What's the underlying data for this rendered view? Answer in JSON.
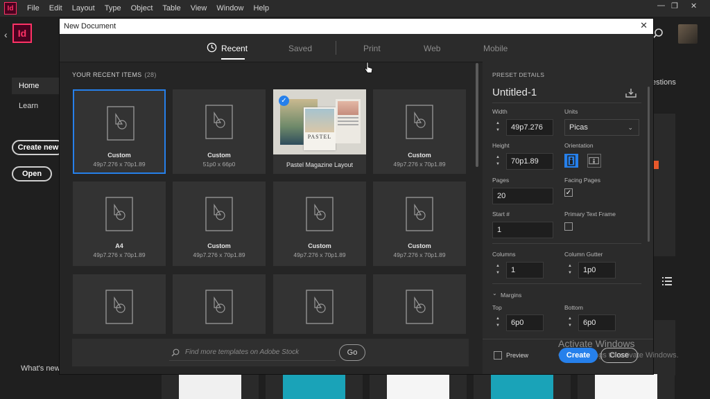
{
  "app": {
    "logo": "Id"
  },
  "menubar": {
    "items": [
      "File",
      "Edit",
      "Layout",
      "Type",
      "Object",
      "Table",
      "View",
      "Window",
      "Help"
    ]
  },
  "home": {
    "nav": [
      "Home",
      "Learn"
    ],
    "create_new": "Create new",
    "open": "Open",
    "whats_new": "What's new",
    "questions": "estions"
  },
  "dialog": {
    "title": "New Document",
    "tabs": [
      "Recent",
      "Saved",
      "Print",
      "Web",
      "Mobile"
    ],
    "recent_header": "YOUR RECENT ITEMS",
    "recent_count": "(28)",
    "cards": [
      {
        "name": "Custom",
        "dims": "49p7.276 x 70p1.89"
      },
      {
        "name": "Custom",
        "dims": "51p0 x 66p0"
      },
      {
        "name": "Pastel Magazine Layout",
        "dims": ""
      },
      {
        "name": "Custom",
        "dims": "49p7.276 x 70p1.89"
      },
      {
        "name": "A4",
        "dims": "49p7.276 x 70p1.89"
      },
      {
        "name": "Custom",
        "dims": "49p7.276 x 70p1.89"
      },
      {
        "name": "Custom",
        "dims": "49p7.276 x 70p1.89"
      },
      {
        "name": "Custom",
        "dims": "49p7.276 x 70p1.89"
      },
      {
        "name": "",
        "dims": ""
      },
      {
        "name": "",
        "dims": ""
      },
      {
        "name": "",
        "dims": ""
      },
      {
        "name": "",
        "dims": ""
      }
    ],
    "thumb_text": "PASTEL",
    "stock_placeholder": "Find more templates on Adobe Stock",
    "go": "Go"
  },
  "preset": {
    "header": "PRESET DETAILS",
    "name": "Untitled-1",
    "width_label": "Width",
    "width": "49p7.276",
    "units_label": "Units",
    "units": "Picas",
    "height_label": "Height",
    "height": "70p1.89",
    "orientation_label": "Orientation",
    "pages_label": "Pages",
    "pages": "20",
    "facing_label": "Facing Pages",
    "facing_checked": true,
    "start_label": "Start #",
    "start": "1",
    "ptf_label": "Primary Text Frame",
    "ptf_checked": false,
    "columns_label": "Columns",
    "columns": "1",
    "gutter_label": "Column Gutter",
    "gutter": "1p0",
    "margins_label": "Margins",
    "top_label": "Top",
    "top": "6p0",
    "bottom_label": "Bottom",
    "bottom": "6p0",
    "preview_label": "Preview",
    "create": "Create",
    "close": "Close"
  },
  "overlay": {
    "activate": "Activate Windows",
    "activate_sub": "Go to Settings to activate Windows."
  },
  "colors": {
    "accent": "#2680eb",
    "brand": "#ff3366"
  }
}
